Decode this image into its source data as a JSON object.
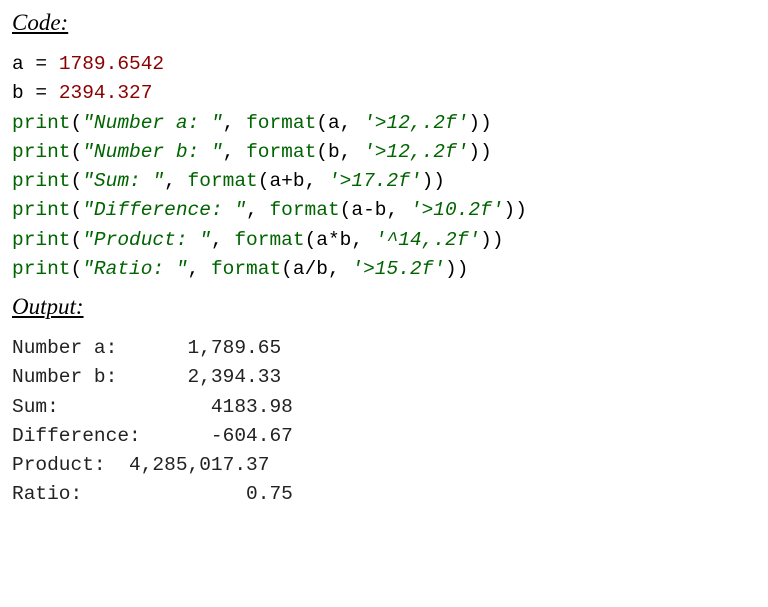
{
  "headings": {
    "code": "Code:",
    "output": "Output:"
  },
  "code": {
    "line1": {
      "lhs": "a",
      "eq": " = ",
      "rhs": "1789.6542"
    },
    "line2": {
      "lhs": "b",
      "eq": " = ",
      "rhs": "2394.327"
    },
    "line3": {
      "fn1": "print",
      "p1": "(",
      "s1": "\"Number a: \"",
      "c1": ", ",
      "fn2": "format",
      "p2": "(a, ",
      "fmt": "'>12,.2f'",
      "p3": "))"
    },
    "line4": {
      "fn1": "print",
      "p1": "(",
      "s1": "\"Number b: \"",
      "c1": ", ",
      "fn2": "format",
      "p2": "(b, ",
      "fmt": "'>12,.2f'",
      "p3": "))"
    },
    "line5": {
      "fn1": "print",
      "p1": "(",
      "s1": "\"Sum: \"",
      "c1": ", ",
      "fn2": "format",
      "p2": "(a+b, ",
      "fmt": "'>17.2f'",
      "p3": "))"
    },
    "line6": {
      "fn1": "print",
      "p1": "(",
      "s1": "\"Difference: \"",
      "c1": ", ",
      "fn2": "format",
      "p2": "(a-b, ",
      "fmt": "'>10.2f'",
      "p3": "))"
    },
    "line7": {
      "fn1": "print",
      "p1": "(",
      "s1": "\"Product: \"",
      "c1": ", ",
      "fn2": "format",
      "p2": "(a*b, ",
      "fmt": "'^14,.2f'",
      "p3": "))"
    },
    "line8": {
      "fn1": "print",
      "p1": "(",
      "s1": "\"Ratio: \"",
      "c1": ", ",
      "fn2": "format",
      "p2": "(a/b, ",
      "fmt": "'>15.2f'",
      "p3": "))"
    }
  },
  "output": {
    "l1": "Number a:      1,789.65",
    "l2": "Number b:      2,394.33",
    "l3": "Sum:             4183.98",
    "l4": "Difference:      -604.67",
    "l5": "Product:  4,285,017.37",
    "l6": "Ratio:              0.75"
  }
}
